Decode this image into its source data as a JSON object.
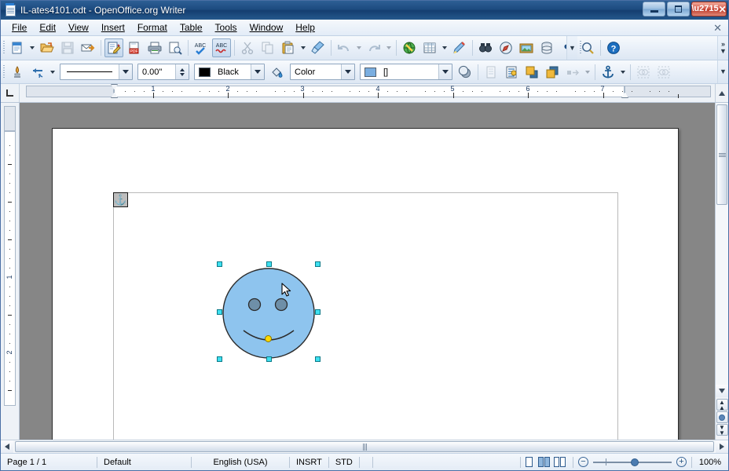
{
  "window": {
    "title": "IL-ates4101.odt - OpenOffice.org Writer",
    "app_icon": "writer-document-icon",
    "minimize_label": "Minimize",
    "maximize_label": "Restore",
    "close_label": "Close"
  },
  "menubar": {
    "items": [
      {
        "label": "File"
      },
      {
        "label": "Edit"
      },
      {
        "label": "View"
      },
      {
        "label": "Insert"
      },
      {
        "label": "Format"
      },
      {
        "label": "Table"
      },
      {
        "label": "Tools"
      },
      {
        "label": "Window"
      },
      {
        "label": "Help"
      }
    ],
    "close_document": "✕"
  },
  "standard_toolbar": {
    "buttons": [
      {
        "name": "new-icon",
        "label": "New"
      },
      {
        "name": "new-dropdown-icon",
        "label": "New dropdown"
      },
      {
        "name": "open-icon",
        "label": "Open"
      },
      {
        "name": "save-icon",
        "label": "Save"
      },
      {
        "name": "email-icon",
        "label": "E-mail Document"
      },
      {
        "name": "edit-file-icon",
        "label": "Edit File"
      },
      {
        "name": "export-pdf-icon",
        "label": "Export Directly as PDF"
      },
      {
        "name": "print-icon",
        "label": "Print File Directly"
      },
      {
        "name": "print-preview-icon",
        "label": "Page Preview"
      },
      {
        "name": "spelling-icon",
        "label": "Spelling and Grammar"
      },
      {
        "name": "autospellcheck-icon",
        "label": "AutoSpellcheck"
      },
      {
        "name": "cut-icon",
        "label": "Cut"
      },
      {
        "name": "copy-icon",
        "label": "Copy"
      },
      {
        "name": "paste-icon",
        "label": "Paste"
      },
      {
        "name": "paste-dropdown-icon",
        "label": "Paste dropdown"
      },
      {
        "name": "clone-formatting-icon",
        "label": "Clone Formatting"
      },
      {
        "name": "undo-icon",
        "label": "Undo"
      },
      {
        "name": "undo-dropdown-icon",
        "label": "Undo dropdown"
      },
      {
        "name": "redo-icon",
        "label": "Redo"
      },
      {
        "name": "redo-dropdown-icon",
        "label": "Redo dropdown"
      },
      {
        "name": "hyperlink-icon",
        "label": "Hyperlink"
      },
      {
        "name": "table-icon",
        "label": "Table"
      },
      {
        "name": "table-dropdown-icon",
        "label": "Table dropdown"
      },
      {
        "name": "show-draw-functions-icon",
        "label": "Show Draw Functions"
      },
      {
        "name": "find-replace-icon",
        "label": "Find & Replace"
      },
      {
        "name": "navigator-icon",
        "label": "Navigator"
      },
      {
        "name": "gallery-icon",
        "label": "Gallery"
      },
      {
        "name": "data-sources-icon",
        "label": "Data Sources"
      },
      {
        "name": "formatting-marks-icon",
        "label": "Formatting Marks"
      },
      {
        "name": "zoom-icon",
        "label": "Zoom"
      },
      {
        "name": "help-icon",
        "label": "OpenOffice.org Help"
      }
    ],
    "overflow": "»"
  },
  "drawing_properties_toolbar": {
    "line_icon": "line-icon",
    "arrow_style_icon": "arrow-style-icon",
    "line_style": {
      "name": "line-style-dropdown",
      "value": "——————"
    },
    "line_width": {
      "name": "line-width-spinner",
      "value": "0.00\""
    },
    "line_color": {
      "name": "line-color-dropdown",
      "value": "Black",
      "swatch": "#000000"
    },
    "fill_area_icon": "fill-area-style-icon",
    "fill_style": {
      "name": "area-style-dropdown",
      "value": "Color"
    },
    "fill_color": {
      "name": "fill-color-dropdown",
      "value": "[]",
      "swatch": "#7aaee0"
    },
    "buttons": [
      {
        "name": "shadow-icon",
        "label": "Shadow"
      },
      {
        "name": "wrap-off-icon",
        "label": "Wrap Off"
      },
      {
        "name": "wrap-on-icon",
        "label": "Wrap On"
      },
      {
        "name": "bring-to-front-icon",
        "label": "Bring to Front"
      },
      {
        "name": "send-to-back-icon",
        "label": "Send to Back"
      },
      {
        "name": "alignment-icon",
        "label": "Alignment"
      },
      {
        "name": "alignment-dropdown-icon",
        "label": "Alignment dropdown"
      },
      {
        "name": "anchor-icon",
        "label": "Change Anchor"
      },
      {
        "name": "anchor-dropdown-icon",
        "label": "Anchor dropdown"
      },
      {
        "name": "ungroup-icon",
        "label": "Ungroup"
      },
      {
        "name": "group-icon",
        "label": "Group"
      }
    ]
  },
  "ruler": {
    "tab_selector_icon": "tab-stop-left-icon",
    "horizontal_labels": [
      "1",
      "2",
      "3",
      "4",
      "5",
      "6",
      "7"
    ],
    "vertical_labels": [
      "1",
      "2"
    ],
    "unit": "inch"
  },
  "document": {
    "anchor_icon": "anchor-icon",
    "shape": {
      "name": "smiley-face-shape",
      "fill_color": "#8ec4ee",
      "border_color": "#2b2b2b",
      "eye_color": "#6e8fa8",
      "selected": true,
      "handle_color": "#3ee0f0",
      "adjust_handle_color": "#ffd900",
      "handle_count": 8
    },
    "cursor_icon": "mouse-pointer-icon"
  },
  "scrollbars": {
    "vertical_up_icon": "scroll-up-icon",
    "vertical_down_icon": "scroll-down-icon",
    "horizontal_left_icon": "scroll-left-icon",
    "horizontal_right_icon": "scroll-right-icon",
    "previous_page_icon": "previous-page-icon",
    "navigation_icon": "navigation-icon",
    "next_page_icon": "next-page-icon"
  },
  "statusbar": {
    "page": "Page 1 / 1",
    "page_style": "Default",
    "language": "English (USA)",
    "insert_mode": "INSRT",
    "selection_mode": "STD",
    "modified": "",
    "signature": "",
    "view_layouts": [
      {
        "name": "single-page-view-icon",
        "label": "Single Page"
      },
      {
        "name": "multi-page-view-icon",
        "label": "Multiple Pages"
      },
      {
        "name": "book-view-icon",
        "label": "Book View"
      }
    ],
    "zoom_out_label": "−",
    "zoom_in_label": "+",
    "zoom_value": "100%"
  }
}
